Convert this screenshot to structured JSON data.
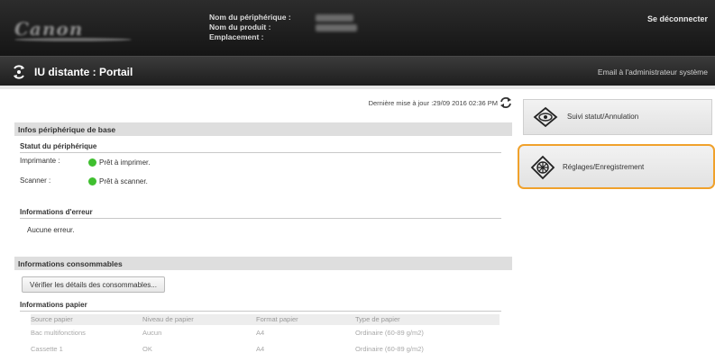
{
  "header": {
    "logo_text": "Canon",
    "device_name_label": "Nom du périphérique :",
    "product_name_label": "Nom du produit :",
    "location_label": "Emplacement :",
    "logout_label": "Se déconnecter"
  },
  "titlebar": {
    "title": "IU distante : Portail",
    "admin_email": "Email à l'administrateur système"
  },
  "main": {
    "last_update": "Dernière mise à jour :29/09 2016 02:36 PM",
    "basic_info": {
      "heading": "Infos périphérique de base",
      "status_heading": "Statut du périphérique",
      "printer_label": "Imprimante :",
      "printer_status": "Prêt à imprimer.",
      "scanner_label": "Scanner :",
      "scanner_status": "Prêt à scanner.",
      "error_heading": "Informations d'erreur",
      "error_text": "Aucune erreur."
    },
    "consumables": {
      "heading": "Informations consommables",
      "check_button": "Vérifier les détails des consommables...",
      "paper_heading": "Informations papier",
      "columns": [
        "Source papier",
        "Niveau de papier",
        "Format papier",
        "Type de papier"
      ],
      "rows": [
        [
          "Bac multifonctions",
          "Aucun",
          "A4",
          "Ordinaire (60-89 g/m2)"
        ],
        [
          "Cassette 1",
          "OK",
          "A4",
          "Ordinaire (60-89 g/m2)"
        ]
      ]
    }
  },
  "right_panel": {
    "status_button": "Suivi statut/Annulation",
    "settings_button": "Réglages/Enregistrement"
  },
  "colors": {
    "status_ok": "#3fbf2f",
    "selection_outline": "#f0a12b"
  }
}
